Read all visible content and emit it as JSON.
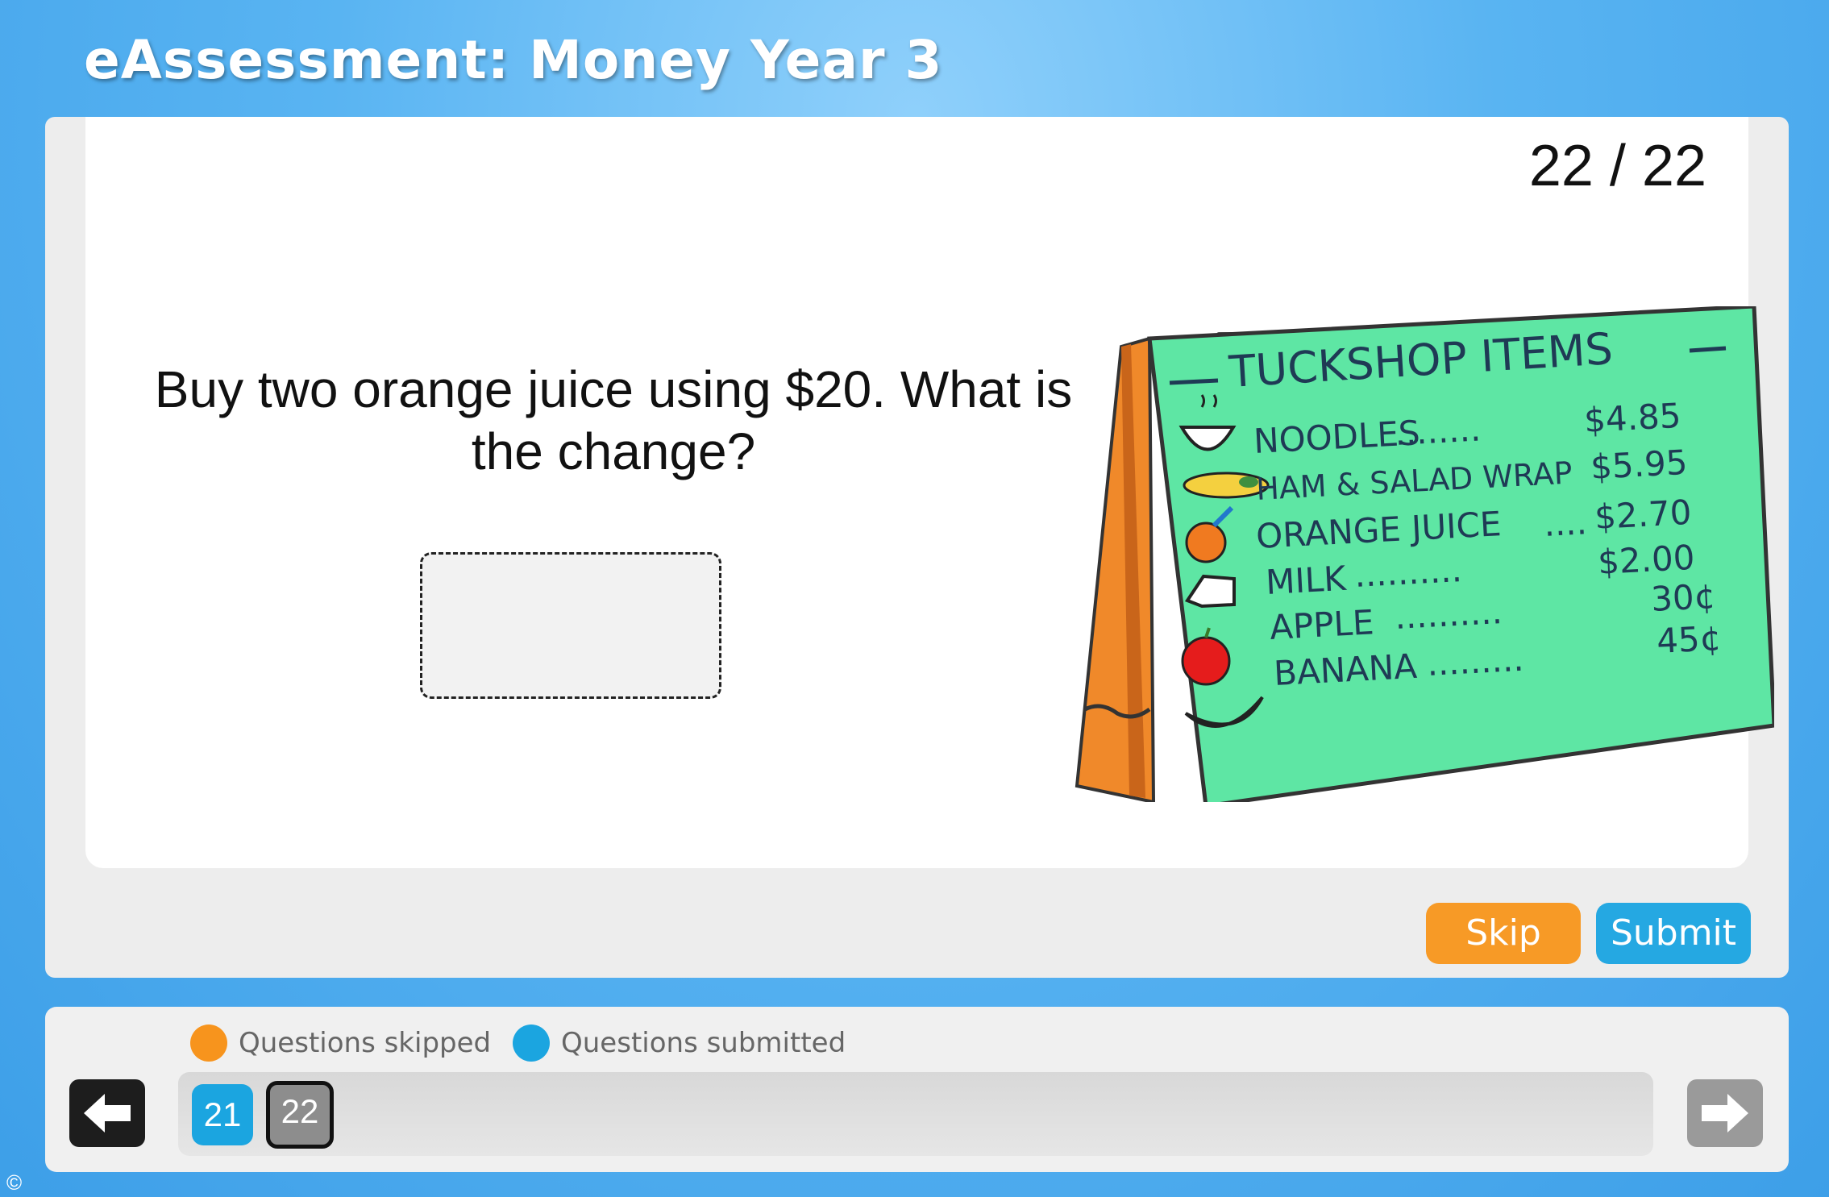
{
  "header": {
    "title": "eAssessment: Money Year 3"
  },
  "question": {
    "counter": "22 / 22",
    "text": "Buy two orange juice using $20. What is the change?",
    "answer_value": ""
  },
  "sign": {
    "title": "TUCKSHOP ITEMS",
    "items": [
      {
        "name": "NOODLES",
        "price": "$4.85",
        "icon": "noodles-icon"
      },
      {
        "name": "HAM & SALAD WRAP",
        "price": "$5.95",
        "icon": "wrap-icon"
      },
      {
        "name": "ORANGE JUICE",
        "price": "$2.70",
        "icon": "orange-icon"
      },
      {
        "name": "MILK",
        "price": "$2.00",
        "icon": "milk-carton-icon"
      },
      {
        "name": "APPLE",
        "price": "30¢",
        "icon": "apple-icon"
      },
      {
        "name": "BANANA",
        "price": "45¢",
        "icon": "banana-icon"
      }
    ]
  },
  "actions": {
    "skip_label": "Skip",
    "submit_label": "Submit"
  },
  "navigator": {
    "legend_skipped": "Questions skipped",
    "legend_submitted": "Questions submitted",
    "questions": [
      {
        "number": "21",
        "status": "submitted"
      },
      {
        "number": "22",
        "status": "current"
      }
    ],
    "prev_icon": "arrow-left-icon",
    "next_icon": "arrow-right-icon"
  },
  "footer": {
    "copyright": "©"
  },
  "colors": {
    "background": "#4aa8ee",
    "skip": "#f79a26",
    "submit": "#25a8e2",
    "sign_board": "#5ee6a4",
    "sign_frame": "#e07a1c"
  }
}
